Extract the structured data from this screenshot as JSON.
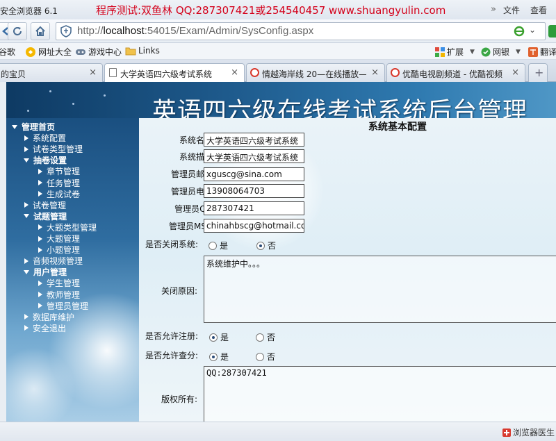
{
  "browser": {
    "app_title": "安全浏览器 6.1",
    "promo_text": "程序测试:双鱼林 QQ:287307421或254540457 www.shuangyulin.com",
    "menu": [
      "文件",
      "查看"
    ],
    "url_prefix": "http://",
    "url_host": "localhost",
    "url_rest": ":54015/Exam/Admin/SysConfig.aspx",
    "bookmarks": [
      "谷歌",
      "网址大全",
      "游戏中心",
      "Links"
    ],
    "extensions": [
      "扩展",
      "网银",
      "翻译"
    ],
    "tabs": [
      {
        "label": "的宝贝",
        "active": false
      },
      {
        "label": "大学英语四六级考试系统",
        "active": true
      },
      {
        "label": "情越海岸线 20—在线播放—",
        "active": false
      },
      {
        "label": "优酷电视剧频道 - 优酷视频",
        "active": false
      }
    ],
    "close_glyph": "×",
    "new_tab_glyph": "+",
    "status_text": "浏览器医生"
  },
  "page": {
    "banner_title": "英语四六级在线考试系统后台管理",
    "sidebar": [
      {
        "label": "管理首页",
        "level": 0,
        "group": true
      },
      {
        "label": "系统配置",
        "level": 1,
        "group": false
      },
      {
        "label": "试卷类型管理",
        "level": 1,
        "group": false
      },
      {
        "label": "抽卷设置",
        "level": 1,
        "group": true
      },
      {
        "label": "章节管理",
        "level": 2,
        "group": false
      },
      {
        "label": "任务管理",
        "level": 2,
        "group": false
      },
      {
        "label": "生成试卷",
        "level": 2,
        "group": false
      },
      {
        "label": "试卷管理",
        "level": 1,
        "group": false
      },
      {
        "label": "试题管理",
        "level": 1,
        "group": true
      },
      {
        "label": "大题类型管理",
        "level": 2,
        "group": false
      },
      {
        "label": "大题管理",
        "level": 2,
        "group": false
      },
      {
        "label": "小题管理",
        "level": 2,
        "group": false
      },
      {
        "label": "音频视频管理",
        "level": 1,
        "group": false
      },
      {
        "label": "用户管理",
        "level": 1,
        "group": true
      },
      {
        "label": "学生管理",
        "level": 2,
        "group": false
      },
      {
        "label": "教师管理",
        "level": 2,
        "group": false
      },
      {
        "label": "管理员管理",
        "level": 2,
        "group": false
      },
      {
        "label": "数据库维护",
        "level": 1,
        "group": false
      },
      {
        "label": "安全退出",
        "level": 1,
        "group": false
      }
    ],
    "form": {
      "title": "系统基本配置",
      "system_name": {
        "label": "系统名称:",
        "value": "大学英语四六级考试系统"
      },
      "system_desc": {
        "label": "系统描述:",
        "value": "大学英语四六级考试系统"
      },
      "admin_email": {
        "label": "管理员邮箱:",
        "value": "xguscg@sina.com"
      },
      "admin_phone": {
        "label": "管理员电话:",
        "value": "13908064703"
      },
      "admin_qq": {
        "label": "管理员QQ:",
        "value": "287307421"
      },
      "admin_msn": {
        "label": "管理员MSN:",
        "value": "chinahbscg@hotmail.com"
      },
      "close_system": {
        "label": "是否关闭系统:",
        "yes": "是",
        "no": "否",
        "selected": "no"
      },
      "close_reason": {
        "label": "关闭原因:",
        "value": "系统维护中。。。"
      },
      "allow_register": {
        "label": "是否允许注册:",
        "yes": "是",
        "no": "否",
        "selected": "yes"
      },
      "allow_query": {
        "label": "是否允许查分:",
        "yes": "是",
        "no": "否",
        "selected": "yes"
      },
      "copyright": {
        "label": "版权所有:",
        "value": "QQ:287307421"
      }
    }
  }
}
